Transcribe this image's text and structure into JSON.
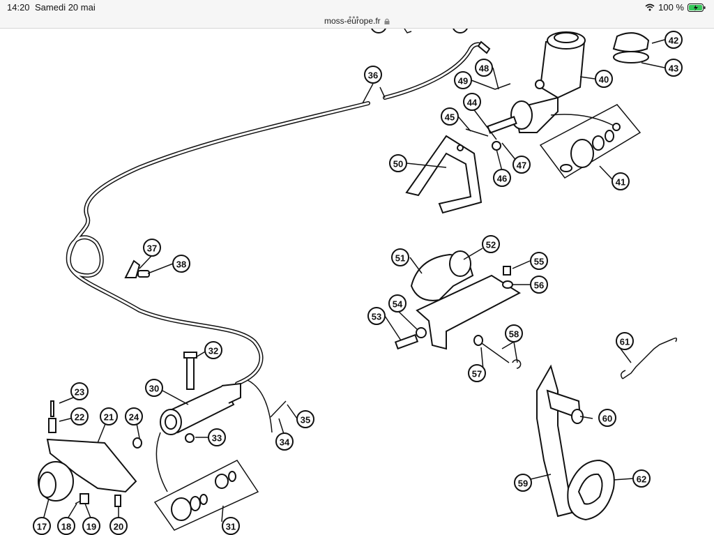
{
  "status_bar": {
    "time": "14:20",
    "date": "Samedi 20 mai",
    "battery": "100 %"
  },
  "browser": {
    "url": "moss-europe.fr"
  },
  "diagram": {
    "callouts": [
      "17",
      "18",
      "19",
      "20",
      "21",
      "22",
      "23",
      "24",
      "30",
      "31",
      "32",
      "33",
      "34",
      "35",
      "36",
      "37",
      "38",
      "40",
      "41",
      "42",
      "43",
      "44",
      "45",
      "46",
      "47",
      "48",
      "49",
      "50",
      "51",
      "52",
      "53",
      "54",
      "55",
      "56",
      "57",
      "58",
      "59",
      "60",
      "61",
      "62"
    ]
  }
}
